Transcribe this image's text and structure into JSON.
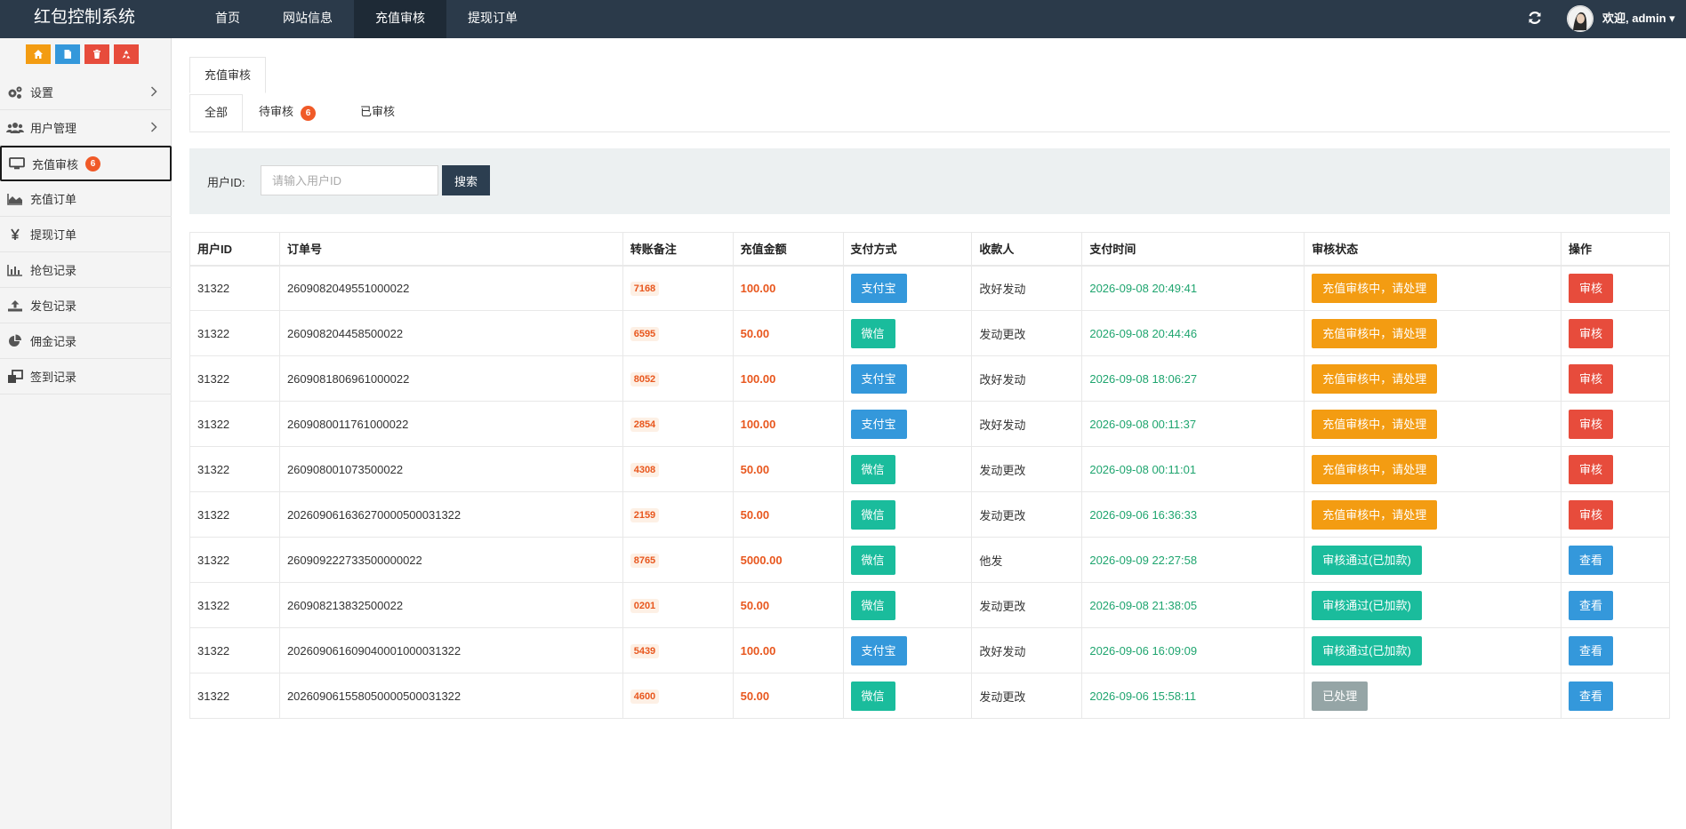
{
  "header": {
    "brand": "红包控制系统",
    "nav": [
      {
        "label": "首页",
        "active": false
      },
      {
        "label": "网站信息",
        "active": false
      },
      {
        "label": "充值审核",
        "active": true
      },
      {
        "label": "提现订单",
        "active": false
      }
    ],
    "welcome": "欢迎, admin ▾"
  },
  "sidebar": {
    "quick_buttons": [
      {
        "icon": "home-icon",
        "color": "#f39c12"
      },
      {
        "icon": "file-icon",
        "color": "#3498db"
      },
      {
        "icon": "trash-icon",
        "color": "#e74c3c"
      },
      {
        "icon": "recycle-icon",
        "color": "#e74c3c"
      }
    ],
    "items": [
      {
        "label": "设置",
        "icon": "gears-icon",
        "has_arrow": true
      },
      {
        "label": "用户管理",
        "icon": "users-icon",
        "has_arrow": true
      },
      {
        "label": "充值审核",
        "icon": "desktop-icon",
        "badge": "6",
        "active": true
      },
      {
        "label": "充值订单",
        "icon": "area-chart-icon"
      },
      {
        "label": "提现订单",
        "icon": "yen-icon"
      },
      {
        "label": "抢包记录",
        "icon": "bar-chart-icon"
      },
      {
        "label": "发包记录",
        "icon": "upload-icon"
      },
      {
        "label": "佣金记录",
        "icon": "pie-chart-icon"
      },
      {
        "label": "签到记录",
        "icon": "clone-icon"
      }
    ]
  },
  "main": {
    "outer_tab": "充值审核",
    "subtabs": [
      {
        "label": "全部",
        "active": true
      },
      {
        "label": "待审核",
        "badge": "6"
      },
      {
        "label": "已审核"
      }
    ],
    "search": {
      "label": "用户ID:",
      "placeholder": "请输入用户ID",
      "value": "",
      "button": "搜索"
    },
    "table": {
      "columns": [
        "用户ID",
        "订单号",
        "转账备注",
        "充值金额",
        "支付方式",
        "收款人",
        "支付时间",
        "审核状态",
        "操作"
      ],
      "rows": [
        {
          "uid": "31322",
          "order": "2609082049551000022",
          "memo": "7168",
          "amount": "100.00",
          "pay": "支付宝",
          "pay_type": "alipay",
          "payee": "改好发动",
          "time": "2026-09-08 20:49:41",
          "status": "充值审核中，请处理",
          "status_type": "pending",
          "action": "审核",
          "action_type": "review"
        },
        {
          "uid": "31322",
          "order": "260908204458500022",
          "memo": "6595",
          "amount": "50.00",
          "pay": "微信",
          "pay_type": "wechat",
          "payee": "发动更改",
          "time": "2026-09-08 20:44:46",
          "status": "充值审核中，请处理",
          "status_type": "pending",
          "action": "审核",
          "action_type": "review"
        },
        {
          "uid": "31322",
          "order": "2609081806961000022",
          "memo": "8052",
          "amount": "100.00",
          "pay": "支付宝",
          "pay_type": "alipay",
          "payee": "改好发动",
          "time": "2026-09-08 18:06:27",
          "status": "充值审核中，请处理",
          "status_type": "pending",
          "action": "审核",
          "action_type": "review"
        },
        {
          "uid": "31322",
          "order": "2609080011761000022",
          "memo": "2854",
          "amount": "100.00",
          "pay": "支付宝",
          "pay_type": "alipay",
          "payee": "改好发动",
          "time": "2026-09-08 00:11:37",
          "status": "充值审核中，请处理",
          "status_type": "pending",
          "action": "审核",
          "action_type": "review"
        },
        {
          "uid": "31322",
          "order": "260908001073500022",
          "memo": "4308",
          "amount": "50.00",
          "pay": "微信",
          "pay_type": "wechat",
          "payee": "发动更改",
          "time": "2026-09-08 00:11:01",
          "status": "充值审核中，请处理",
          "status_type": "pending",
          "action": "审核",
          "action_type": "review"
        },
        {
          "uid": "31322",
          "order": "20260906163627000050003​1322",
          "memo": "2159",
          "amount": "50.00",
          "pay": "微信",
          "pay_type": "wechat",
          "payee": "发动更改",
          "time": "2026-09-06 16:36:33",
          "status": "充值审核中，请处理",
          "status_type": "pending",
          "action": "审核",
          "action_type": "review"
        },
        {
          "uid": "31322",
          "order": "260909222733500000022",
          "memo": "8765",
          "amount": "5000.00",
          "pay": "微信",
          "pay_type": "wechat",
          "payee": "他发",
          "time": "2026-09-09 22:27:58",
          "status": "审核通过(已加款)",
          "status_type": "approved",
          "action": "查看",
          "action_type": "view"
        },
        {
          "uid": "31322",
          "order": "260908213832500022",
          "memo": "0201",
          "amount": "50.00",
          "pay": "微信",
          "pay_type": "wechat",
          "payee": "发动更改",
          "time": "2026-09-08 21:38:05",
          "status": "审核通过(已加款)",
          "status_type": "approved",
          "action": "查看",
          "action_type": "view"
        },
        {
          "uid": "31322",
          "order": "202609061609040001000031322",
          "memo": "5439",
          "amount": "100.00",
          "pay": "支付宝",
          "pay_type": "alipay",
          "payee": "改好发动",
          "time": "2026-09-06 16:09:09",
          "status": "审核通过(已加款)",
          "status_type": "approved",
          "action": "查看",
          "action_type": "view"
        },
        {
          "uid": "31322",
          "order": "202609061558050000500031322",
          "memo": "4600",
          "amount": "50.00",
          "pay": "微信",
          "pay_type": "wechat",
          "payee": "发动更改",
          "time": "2026-09-06 15:58:11",
          "status": "已处理",
          "status_type": "processed",
          "action": "查看",
          "action_type": "view"
        }
      ]
    }
  }
}
